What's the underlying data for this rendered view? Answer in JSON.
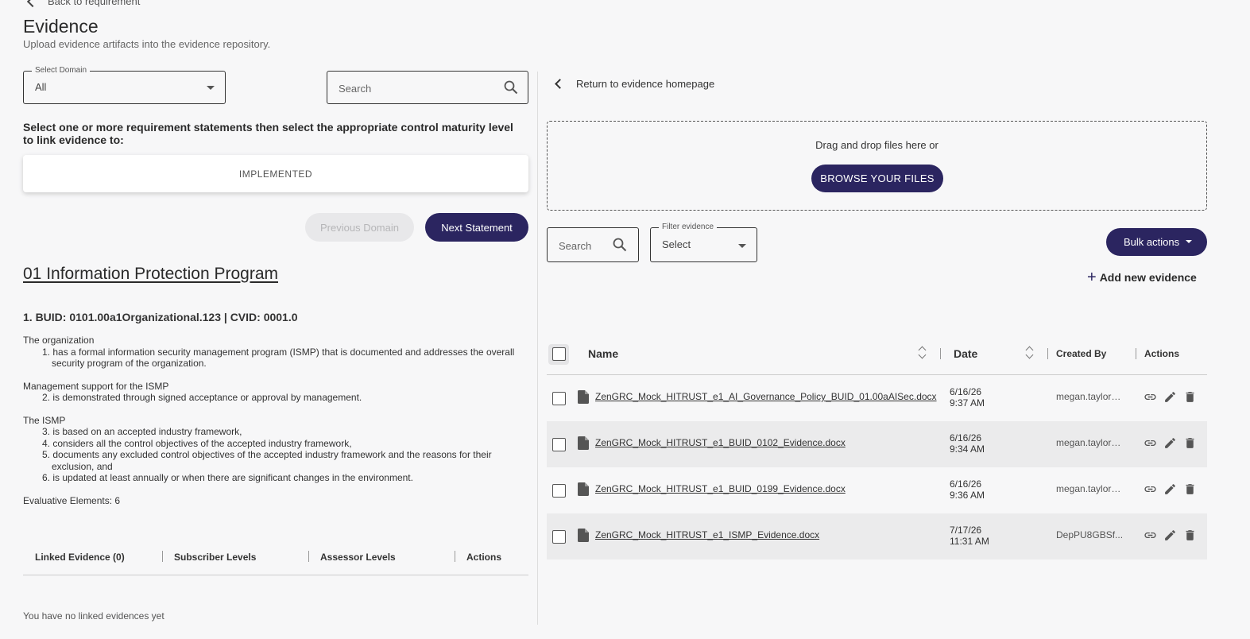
{
  "header": {
    "back_label": "Back to requirement",
    "title": "Evidence",
    "subtitle": "Upload evidence artifacts into the evidence repository."
  },
  "left": {
    "domain_select": {
      "label": "Select Domain",
      "value": "All"
    },
    "search": {
      "placeholder": "Search"
    },
    "instruction": "Select one or more requirement statements then select the appropriate control maturity level to link evidence to:",
    "maturity_level": "IMPLEMENTED",
    "prev_button": "Previous Domain",
    "next_button": "Next Statement",
    "section_title": "01 Information Protection Program",
    "requirement_id": "1. BUID: 0101.00a1Organizational.123 | CVID: 0001.0",
    "requirement": {
      "groups": [
        {
          "heading": "The organization",
          "items": [
            "1. has a formal information security management program (ISMP) that is documented and addresses the overall security program of the organization."
          ]
        },
        {
          "heading": "Management support for the ISMP",
          "items": [
            "2. is demonstrated through signed acceptance or approval by management."
          ]
        },
        {
          "heading": "The ISMP",
          "items": [
            "3. is based on an accepted industry framework,",
            "4. considers all the control objectives of the accepted industry framework,",
            "5. documents any excluded control objectives of the accepted industry framework and the reasons for their exclusion, and",
            "6. is updated at least annually or when there are significant changes in the environment."
          ]
        }
      ],
      "evaluative_elements": "Evaluative Elements: 6"
    },
    "linked_table": {
      "columns": [
        "Linked Evidence (0)",
        "Subscriber Levels",
        "Assessor Levels",
        "Actions"
      ],
      "empty_text": "You have no linked evidences yet"
    }
  },
  "right": {
    "return_label": "Return to evidence homepage",
    "dropzone": {
      "text": "Drag and drop files here or",
      "browse_button": "BROWSE YOUR FILES"
    },
    "search": {
      "placeholder": "Search"
    },
    "filter": {
      "label": "Filter evidence",
      "value": "Select"
    },
    "bulk_button": "Bulk actions",
    "add_button": "Add new evidence",
    "table": {
      "columns": {
        "name": "Name",
        "date": "Date",
        "created_by": "Created By",
        "actions": "Actions"
      },
      "rows": [
        {
          "name": "ZenGRC_Mock_HITRUST_e1_AI_Governance_Policy_BUID_01.00aAISec.docx",
          "date": "6/16/26",
          "time": "9:37 AM",
          "created_by": "megan.taylor@zengrc.com"
        },
        {
          "name": "ZenGRC_Mock_HITRUST_e1_BUID_0102_Evidence.docx",
          "date": "6/16/26",
          "time": "9:34 AM",
          "created_by": "megan.taylor@zengrc.com"
        },
        {
          "name": "ZenGRC_Mock_HITRUST_e1_BUID_0199_Evidence.docx",
          "date": "6/16/26",
          "time": "9:36 AM",
          "created_by": "megan.taylor@zengrc.com"
        },
        {
          "name": "ZenGRC_Mock_HITRUST_e1_ISMP_Evidence.docx",
          "date": "7/17/26",
          "time": "11:31 AM",
          "created_by": "DepPU8GBSf..."
        }
      ]
    }
  },
  "colors": {
    "primary": "#2b2560",
    "background": "#f7f7f8",
    "alt_row": "#ebebec"
  }
}
